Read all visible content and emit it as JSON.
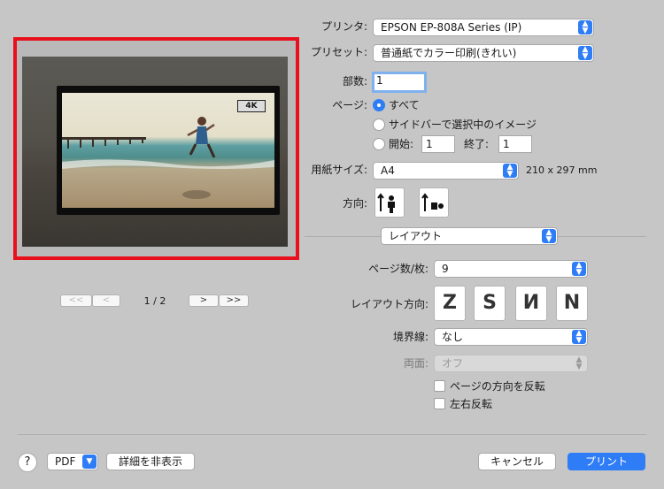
{
  "printer": {
    "label": "プリンタ:",
    "value": "EPSON EP-808A Series (IP)"
  },
  "preset": {
    "label": "プリセット:",
    "value": "普通紙でカラー印刷(きれい)"
  },
  "copies": {
    "label": "部数:",
    "value": "1"
  },
  "pages": {
    "label": "ページ:",
    "all": "すべて",
    "selection": "サイドバーで選択中のイメージ",
    "from_label": "開始:",
    "from_value": "1",
    "to_label": "終了:",
    "to_value": "1"
  },
  "paper_size": {
    "label": "用紙サイズ:",
    "value": "A4",
    "dims": "210 x 297 mm"
  },
  "orientation": {
    "label": "方向:"
  },
  "section": {
    "value": "レイアウト"
  },
  "preview": {
    "badge": "4K",
    "page_indicator": "1 / 2",
    "first": "<<",
    "prev": "<",
    "next": ">",
    "last": ">>"
  },
  "layout": {
    "pages_per_sheet_label": "ページ数/枚:",
    "pages_per_sheet": "9",
    "direction_label": "レイアウト方向:",
    "direction_glyphs": [
      "Z",
      "S",
      "И",
      "N"
    ],
    "border_label": "境界線:",
    "border_value": "なし",
    "duplex_label": "両面:",
    "duplex_value": "オフ",
    "reverse_orientation": "ページの方向を反転",
    "flip_horizontal": "左右反転"
  },
  "footer": {
    "help": "?",
    "pdf": "PDF",
    "hide_details": "詳細を非表示",
    "cancel": "キャンセル",
    "print": "プリント"
  },
  "colors": {
    "accent": "#2f7df6",
    "preview_border": "#e8101c",
    "background": "#c6c6c6"
  },
  "icons": {
    "popup_arrow": "chevron-updown-icon",
    "portrait": "portrait-orientation-icon",
    "landscape": "landscape-orientation-icon"
  }
}
